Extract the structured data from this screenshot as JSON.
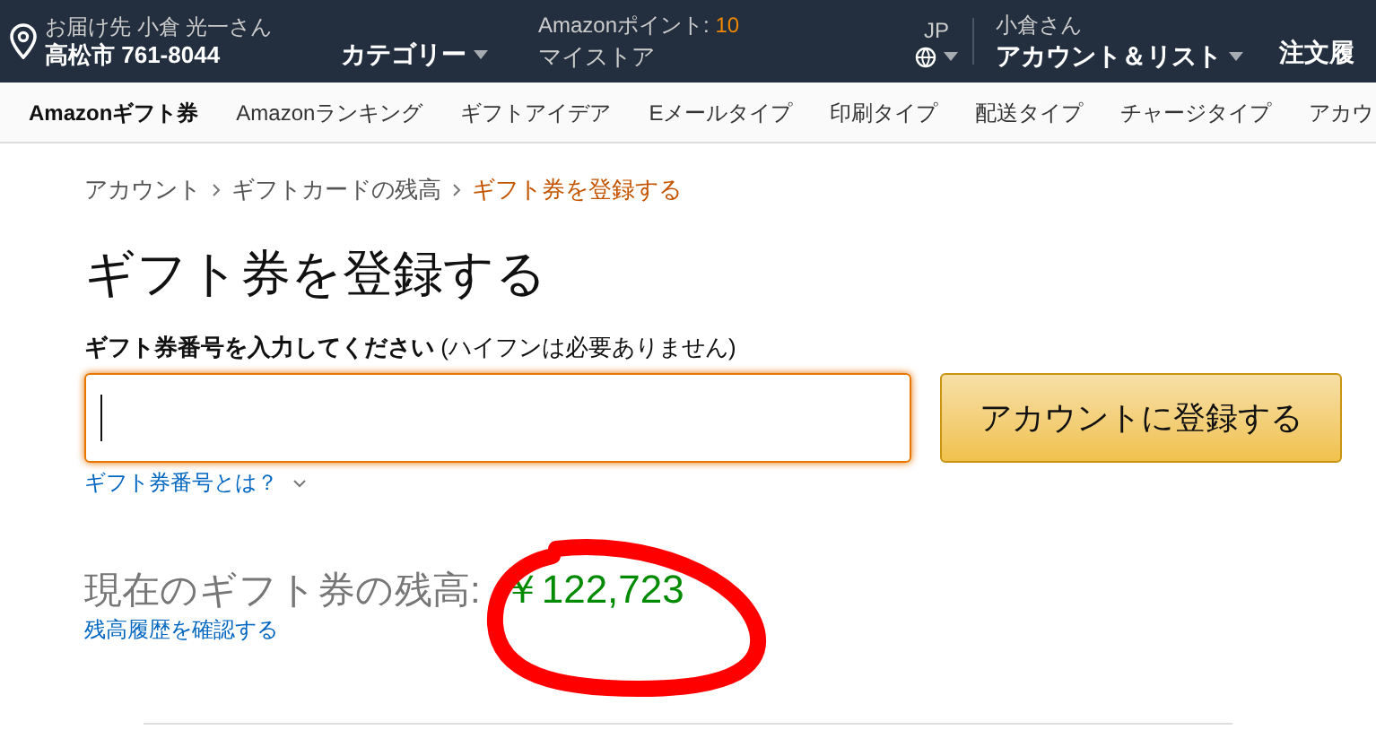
{
  "header": {
    "deliver_to": "お届け先 小倉 光一さん",
    "location": "高松市 761-8044",
    "category": "カテゴリー",
    "points_label": "Amazonポイント: ",
    "points_value": "10",
    "my_store": "マイストア",
    "language": "JP",
    "greeting": "小倉さん",
    "account": "アカウント＆リスト",
    "orders": "注文履"
  },
  "subnav": [
    {
      "label": "Amazonギフト券",
      "selected": true
    },
    {
      "label": "Amazonランキング",
      "selected": false
    },
    {
      "label": "ギフトアイデア",
      "selected": false
    },
    {
      "label": "Eメールタイプ",
      "selected": false
    },
    {
      "label": "印刷タイプ",
      "selected": false
    },
    {
      "label": "配送タイプ",
      "selected": false
    },
    {
      "label": "チャージタイプ",
      "selected": false
    },
    {
      "label": "アカウ",
      "selected": false
    }
  ],
  "breadcrumb": [
    {
      "label": "アカウント",
      "selected": false
    },
    {
      "label": "ギフトカードの残高",
      "selected": false
    },
    {
      "label": "ギフト券を登録する",
      "selected": true
    }
  ],
  "title": "ギフト券を登録する",
  "field": {
    "label": "**ギフト券番号を入力してください** (ハイフンは必要ありません)",
    "focused": true
  },
  "submit": "アカウントに登録する",
  "help_link": "ギフト券番号とは？",
  "balance": {
    "label": "現在のギフト券の残高:",
    "amount": "￥122,723",
    "circled": true
  },
  "history_link": "残高履歴を確認する"
}
